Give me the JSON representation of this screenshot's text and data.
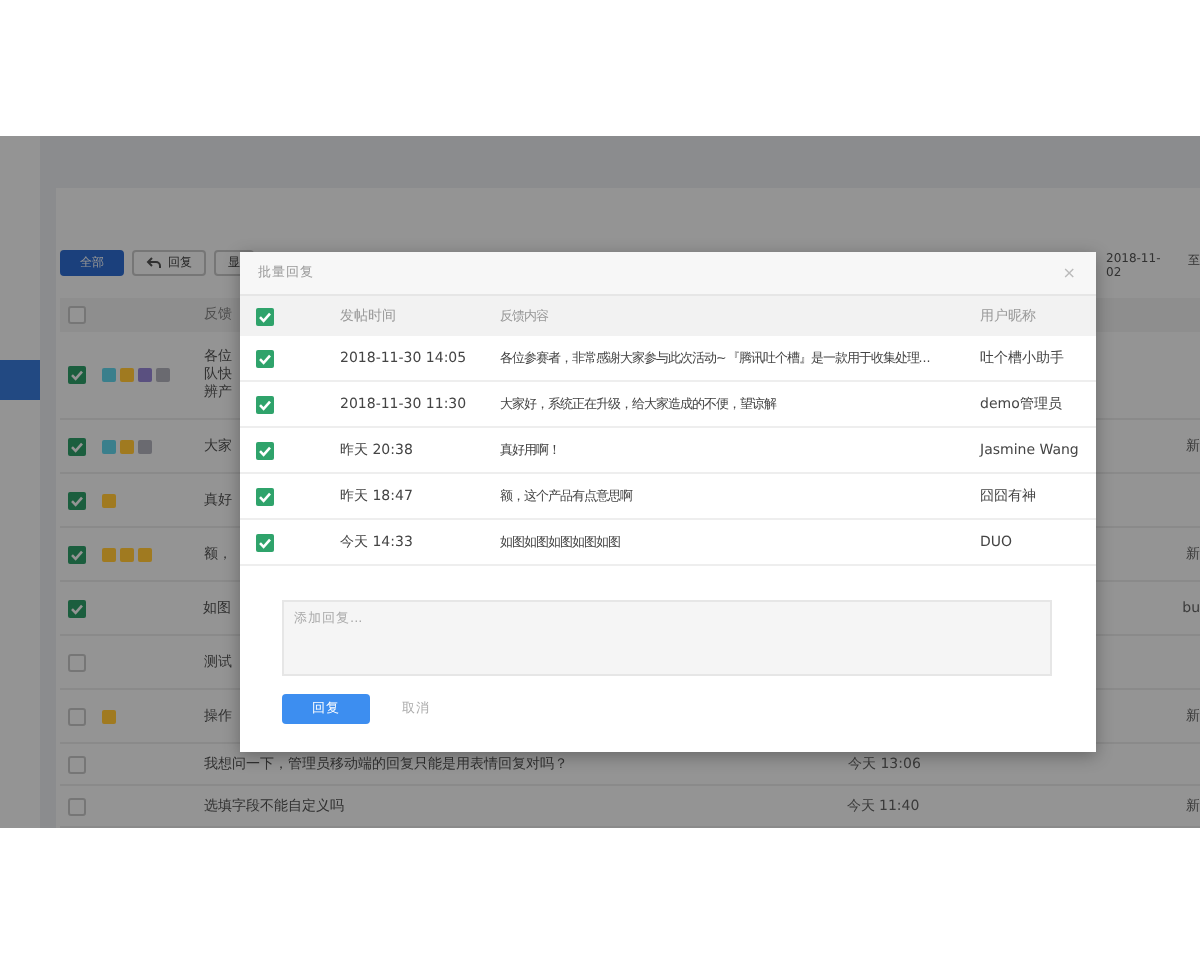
{
  "background": {
    "toolbar": [
      {
        "label": "全部",
        "kind": "primary"
      },
      {
        "label": "回复",
        "kind": "reply"
      },
      {
        "label": "显",
        "kind": "plain"
      }
    ],
    "date_from": "2018-11-02",
    "date_sep": "至",
    "header": {
      "checked": false,
      "column_2": "反馈"
    },
    "rows": [
      {
        "checked": true,
        "tags": [
          {
            "color": "#3a7f8c"
          },
          {
            "color": "#a07a20"
          },
          {
            "color": "#5a5080"
          },
          {
            "color": "#6a6a70"
          }
        ],
        "text_lines": [
          "各位",
          "队快",
          "辨产"
        ]
      },
      {
        "checked": true,
        "tags": [
          {
            "color": "#3a7f8c"
          },
          {
            "color": "#a07a20"
          },
          {
            "color": "#6a6a70"
          }
        ],
        "text_lines": [
          "大家"
        ],
        "column_4": "新"
      },
      {
        "checked": true,
        "tags": [
          {
            "color": "#a07a20"
          }
        ],
        "text_lines": [
          "真好"
        ]
      },
      {
        "checked": true,
        "tags": [
          {
            "color": "#a07a20"
          },
          {
            "color": "#a07a20"
          },
          {
            "color": "#a07a20"
          }
        ],
        "text_lines": [
          "额，"
        ],
        "column_4": "新"
      },
      {
        "checked": true,
        "tags": [],
        "text_lines": [
          "如图"
        ],
        "column_4": "bu"
      },
      {
        "checked": false,
        "tags": [],
        "text_lines": [
          "测试"
        ]
      },
      {
        "checked": false,
        "tags": [
          {
            "color": "#a07a20"
          }
        ],
        "text_lines": [
          "操作"
        ],
        "column_4": "新"
      },
      {
        "checked": false,
        "tags": [],
        "text_lines": [
          "我想问一下，管理员移动端的回复只能是用表情回复对吗？"
        ],
        "time": "今天 13:06"
      },
      {
        "checked": false,
        "tags": [],
        "text_lines": [
          "选填字段不能自定义吗"
        ],
        "time": "今天 11:40",
        "column_4": "新"
      }
    ]
  },
  "dialog": {
    "title": "批量回复",
    "close": "×",
    "columns": {
      "checked": true,
      "time": "发帖时间",
      "content": "反馈内容",
      "user": "用户昵称"
    },
    "rows": [
      {
        "checked": true,
        "time": "2018-11-30 14:05",
        "content": "各位参赛者，非常感谢大家参与此次活动~『腾讯吐个槽』是一款用于收集处理...",
        "user": "吐个槽小助手"
      },
      {
        "checked": true,
        "time": "2018-11-30 11:30",
        "content": "大家好，系统正在升级，给大家造成的不便，望谅解",
        "user": "demo管理员"
      },
      {
        "checked": true,
        "time": "昨天 20:38",
        "content": "真好用啊！",
        "user": "Jasmine Wang"
      },
      {
        "checked": true,
        "time": "昨天 18:47",
        "content": "额，这个产品有点意思啊",
        "user": "囧囧有神"
      },
      {
        "checked": true,
        "time": "今天 14:33",
        "content": "如图如图如图如图如图",
        "user": "DUO"
      }
    ],
    "reply": {
      "placeholder": "添加回复..."
    },
    "buttons": [
      {
        "label": "回复",
        "kind": "primary"
      },
      {
        "label": "取消",
        "kind": "link"
      }
    ]
  }
}
